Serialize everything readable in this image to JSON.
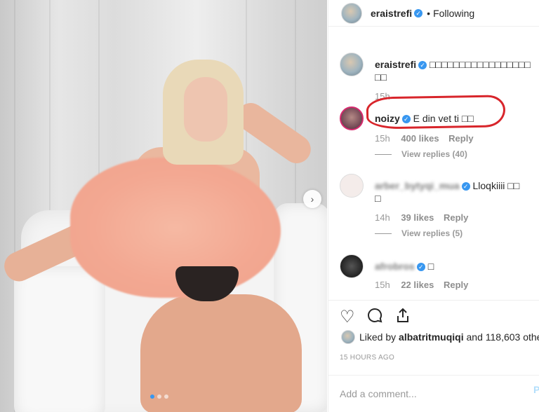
{
  "header": {
    "username": "eraistrefi",
    "verified_glyph": "✓",
    "separator": "•",
    "follow_label": "Following"
  },
  "photo": {
    "next_glyph": "›",
    "carousel_dots": 3,
    "active_dot": 0
  },
  "comments": [
    {
      "user": "eraistrefi",
      "verified": true,
      "text": "□□□□□□□□□□□□□□□□□",
      "text2": "□□",
      "time": "15h"
    },
    {
      "user": "noizy",
      "verified": true,
      "text": "E din vet ti □□",
      "time": "15h",
      "likes": "400 likes",
      "reply": "Reply",
      "replies": "View replies (40)"
    },
    {
      "user": "arber_bytyqi_mua",
      "verified": true,
      "text": "Lloqkiiii □□",
      "text2": "□",
      "time": "14h",
      "likes": "39 likes",
      "reply": "Reply",
      "replies": "View replies (5)"
    },
    {
      "user": "afrobros",
      "verified": true,
      "text": "□",
      "time": "15h",
      "likes": "22 likes",
      "reply": "Reply"
    }
  ],
  "actions": {
    "like_icon": "heart-icon",
    "comment_icon": "comment-icon",
    "share_icon": "share-icon"
  },
  "likes": {
    "prefix": "Liked by",
    "user": "albatritmuqiqi",
    "suffix": "and 118,603 othe"
  },
  "timestamp": "15 HOURS AGO",
  "add_comment": {
    "placeholder": "Add a comment...",
    "post_label": "P"
  },
  "colors": {
    "annotation_red": "#d8252b",
    "verified_blue": "#3897f0",
    "active_dot": "#3897f0"
  }
}
